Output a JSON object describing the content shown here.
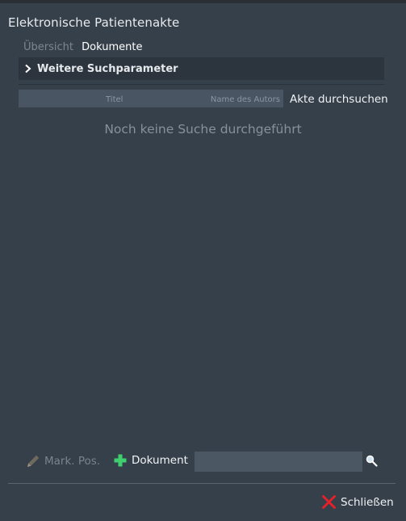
{
  "window": {
    "title": "Elektronische Patientenakte"
  },
  "tabs": [
    {
      "label": "Übersicht",
      "active": false
    },
    {
      "label": "Dokumente",
      "active": true
    }
  ],
  "expander": {
    "label": "Weitere Suchparameter",
    "icon": "chevron-right-icon"
  },
  "search": {
    "title_placeholder": "Titel",
    "author_placeholder": "Name des Autors",
    "button_label": "Akte durchsuchen"
  },
  "results": {
    "empty_message": "Noch keine Suche durchgeführt"
  },
  "toolbar": {
    "mark_pos_label": "Mark. Pos.",
    "add_document_label": "Dokument",
    "search_value": "",
    "icons": [
      "pencil-icon",
      "plus-icon",
      "magnifier-icon"
    ]
  },
  "footer": {
    "close_label": "Schließen",
    "close_icon": "close-x-icon"
  },
  "colors": {
    "background": "#36404b",
    "panel": "#2c343d",
    "field": "#495562",
    "accent_green": "#3fcf6f",
    "close_red": "#e8202a"
  }
}
